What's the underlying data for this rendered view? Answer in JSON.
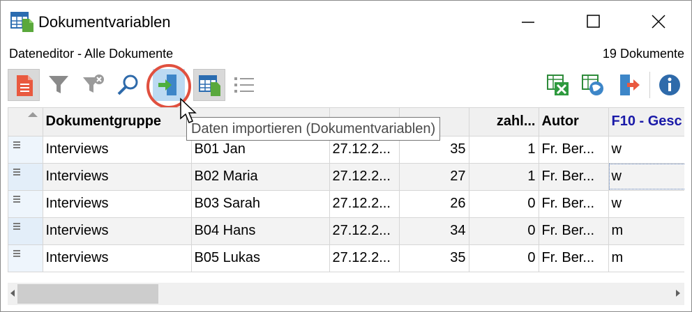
{
  "window": {
    "title": "Dokumentvariablen",
    "colors": {
      "highlight": "#e0503f",
      "header_link": "#1a1aa8"
    }
  },
  "infobar": {
    "left": "Dateneditor - Alle Dokumente",
    "right": "19 Dokumente"
  },
  "toolbar": {
    "icons": [
      "document-list-icon",
      "filter-icon",
      "clear-filter-icon",
      "search-icon",
      "import-icon",
      "table-variables-icon",
      "list-icon",
      "excel-export-icon",
      "web-export-icon",
      "export-icon",
      "info-icon"
    ]
  },
  "tooltip": "Daten importieren (Dokumentvariablen)",
  "table": {
    "headers": [
      "",
      "Dokumentgruppe",
      "",
      "",
      "",
      "zahl...",
      "Autor",
      "F10 - Gesc"
    ],
    "rows": [
      [
        "Interviews",
        "B01 Jan",
        "27.12.2...",
        "35",
        "1",
        "Fr. Ber...",
        "w"
      ],
      [
        "Interviews",
        "B02 Maria",
        "27.12.2...",
        "27",
        "1",
        "Fr. Ber...",
        "w"
      ],
      [
        "Interviews",
        "B03 Sarah",
        "27.12.2...",
        "26",
        "0",
        "Fr. Ber...",
        "w"
      ],
      [
        "Interviews",
        "B04 Hans",
        "27.12.2...",
        "34",
        "0",
        "Fr. Ber...",
        "m"
      ],
      [
        "Interviews",
        "B05 Lukas",
        "27.12.2...",
        "35",
        "0",
        "Fr. Ber...",
        "m"
      ]
    ]
  }
}
